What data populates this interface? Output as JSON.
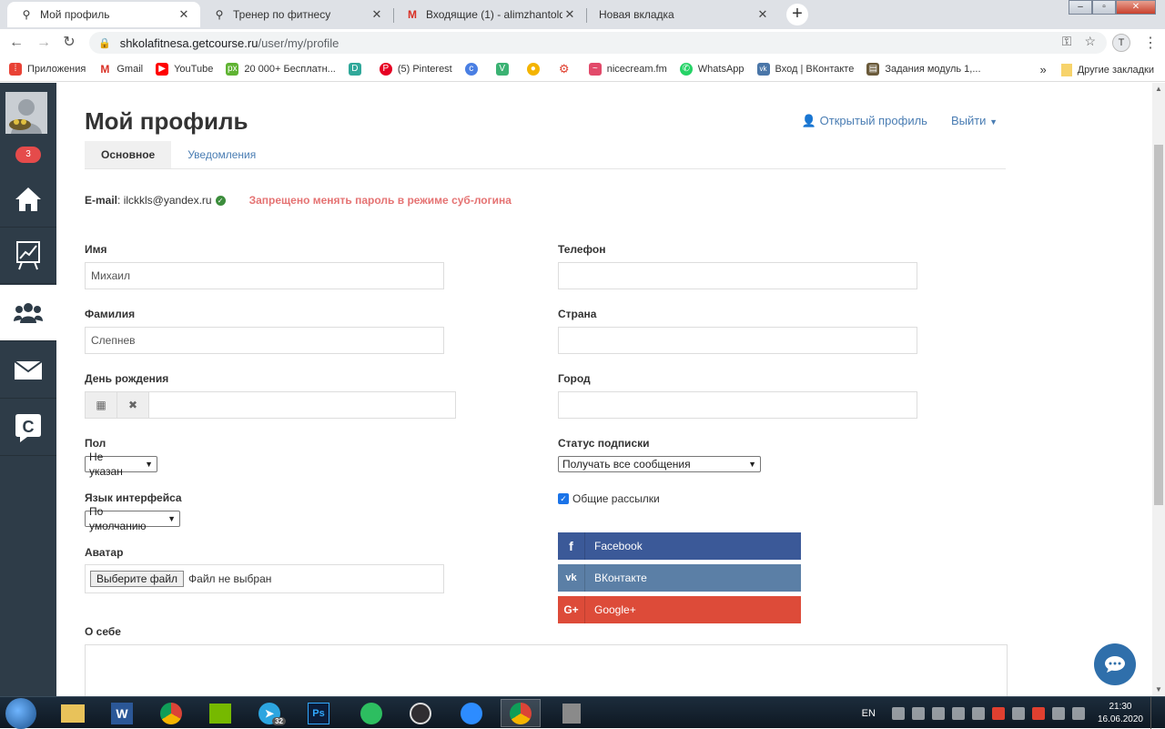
{
  "browser": {
    "tabs": [
      {
        "label": "Мой профиль",
        "active": true
      },
      {
        "label": "Тренер по фитнесу",
        "active": false
      },
      {
        "label": "Входящие (1) - alimzhantolqyna",
        "active": false
      },
      {
        "label": "Новая вкладка",
        "active": false
      }
    ],
    "url_host": "shkolafitnesa.getcourse.ru",
    "url_path": "/user/my/profile",
    "profile_initial": "T",
    "bookmarks": [
      {
        "label": "Приложения",
        "icon": "apps-icon",
        "color": "#e94235"
      },
      {
        "label": "Gmail",
        "icon": "gmail-icon",
        "color": "#d93025"
      },
      {
        "label": "YouTube",
        "icon": "youtube-icon",
        "color": "#ff0000"
      },
      {
        "label": "20 000+ Бесплатн...",
        "icon": "px-icon",
        "color": "#5fb332"
      },
      {
        "label": "",
        "icon": "d-icon",
        "color": "#30a89a"
      },
      {
        "label": "(5) Pinterest",
        "icon": "pinterest-icon",
        "color": "#e60023"
      },
      {
        "label": "",
        "icon": "c-icon",
        "color": "#4a7fe3"
      },
      {
        "label": "",
        "icon": "v-icon",
        "color": "#3bb273"
      },
      {
        "label": "",
        "icon": "chrome-icon",
        "color": "#f4b400"
      },
      {
        "label": "",
        "icon": "gear-red-icon",
        "color": "#e04030"
      },
      {
        "label": "nicecream.fm",
        "icon": "nicecream-icon",
        "color": "#e24a6a"
      },
      {
        "label": "WhatsApp",
        "icon": "whatsapp-icon",
        "color": "#25d366"
      },
      {
        "label": "Вход | ВКонтакте",
        "icon": "vk-icon",
        "color": "#4a76a8"
      },
      {
        "label": "Задания модуль 1,...",
        "icon": "book-icon",
        "color": "#6a5a3a"
      }
    ],
    "more_bookmarks": "»",
    "other_bookmarks": "Другие закладки"
  },
  "sidebar": {
    "badge": "3",
    "items": [
      "home-icon",
      "chart-icon",
      "users-icon",
      "mail-icon",
      "getcourse-icon"
    ]
  },
  "profile": {
    "title": "Мой профиль",
    "open_profile": "Открытый профиль",
    "logout": "Выйти",
    "tabs": [
      "Основное",
      "Уведомления"
    ],
    "email_label": "E-mail",
    "email_value": "ilckkls@yandex.ru",
    "password_warning": "Запрещено менять пароль в режиме суб-логина",
    "fields": {
      "first_name_label": "Имя",
      "first_name_value": "Михаил",
      "last_name_label": "Фамилия",
      "last_name_value": "Слепнев",
      "birthday_label": "День рождения",
      "gender_label": "Пол",
      "gender_value": "Не указан",
      "language_label": "Язык интерфейса",
      "language_value": "По умолчанию",
      "avatar_label": "Аватар",
      "file_button": "Выберите файл",
      "file_none": "Файл не выбран",
      "phone_label": "Телефон",
      "country_label": "Страна",
      "city_label": "Город",
      "subscription_label": "Статус подписки",
      "subscription_value": "Получать все сообщения",
      "newsletter_label": "Общие рассылки",
      "newsletter_checked": true,
      "about_label": "О себе"
    },
    "social": [
      {
        "label": "Facebook",
        "icon": "f",
        "color": "#3b5998"
      },
      {
        "label": "ВКонтакте",
        "icon": "vk",
        "color": "#5b7fa6"
      },
      {
        "label": "Google+",
        "icon": "G+",
        "color": "#dd4b39"
      }
    ]
  },
  "taskbar": {
    "apps": [
      "explorer-icon",
      "word-icon",
      "chrome-icon",
      "nvidia-icon",
      "telegram-icon",
      "photoshop-icon",
      "evernote-icon",
      "obs-icon",
      "zoom-icon",
      "chrome-active-icon",
      "wot-icon"
    ],
    "telegram_badge": "32",
    "lang": "EN",
    "time": "21:30",
    "date": "16.06.2020"
  }
}
